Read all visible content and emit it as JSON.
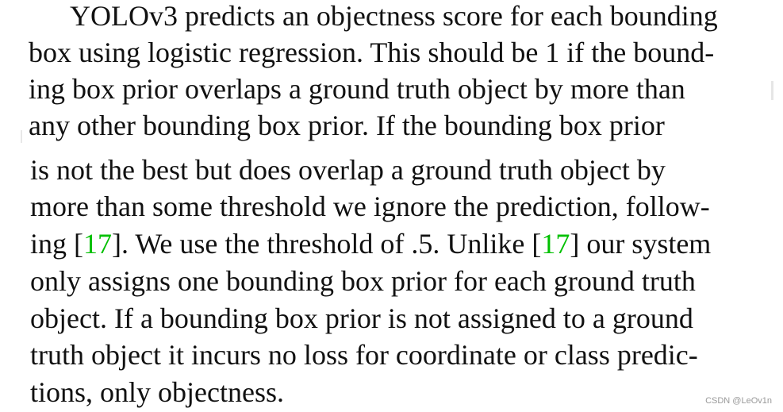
{
  "paragraph": {
    "line1": "YOLOv3 predicts an objectness score for each bounding",
    "line2": "box using logistic regression. This should be 1 if the bound-",
    "line3": "ing box prior overlaps a ground truth object by more than",
    "line4": "any other bounding box prior.  If the bounding box prior",
    "line5": "is not the best but does overlap a ground truth object by",
    "line6": "more than some threshold we ignore the prediction, follow-",
    "line7": {
      "pre": "ing [",
      "cite1": "17",
      "mid": "]. We use the threshold of .5. Unlike [",
      "cite2": "17",
      "post": "] our system"
    },
    "line8": "only assigns one bounding box prior for each ground truth",
    "line9": "object. If a bounding box prior is not assigned to a ground",
    "line10": "truth object it incurs no loss for coordinate or class predic-",
    "line11": "tions, only objectness."
  },
  "colors": {
    "text": "#111111",
    "citation": "#00c000",
    "watermark": "#999999"
  },
  "watermark": "CSDN @LeOv1n"
}
